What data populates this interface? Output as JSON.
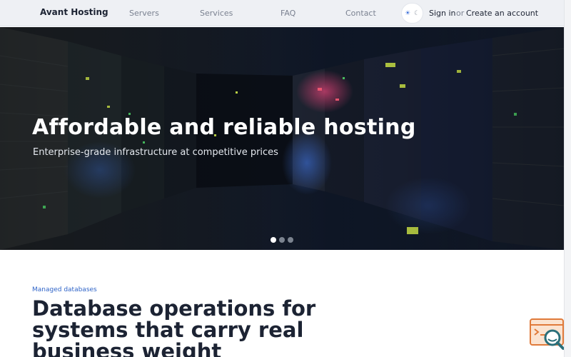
{
  "header": {
    "brand": "Avant Hosting",
    "nav": [
      "Servers",
      "Services",
      "FAQ",
      "Contact"
    ],
    "theme_toggle": {
      "light_icon": "sun-icon",
      "dark_icon": "moon-icon",
      "mode": "light"
    },
    "sign_in": "Sign in",
    "or": "or",
    "create_account": "Create an account"
  },
  "hero": {
    "title": "Affordable and reliable hosting",
    "subtitle": "Enterprise-grade infrastructure at competitive prices",
    "image": "server-room-photo",
    "slides": {
      "count": 3,
      "active": 1
    }
  },
  "section": {
    "eyebrow": "Managed databases",
    "title": "Database operations for systems that carry real business weight"
  },
  "widget": {
    "icon": "support-search-icon",
    "accent": "#e07a3a"
  },
  "colors": {
    "brand": "#1c2333",
    "accent": "#2f64c8",
    "header_bg": "#eef0f4"
  }
}
